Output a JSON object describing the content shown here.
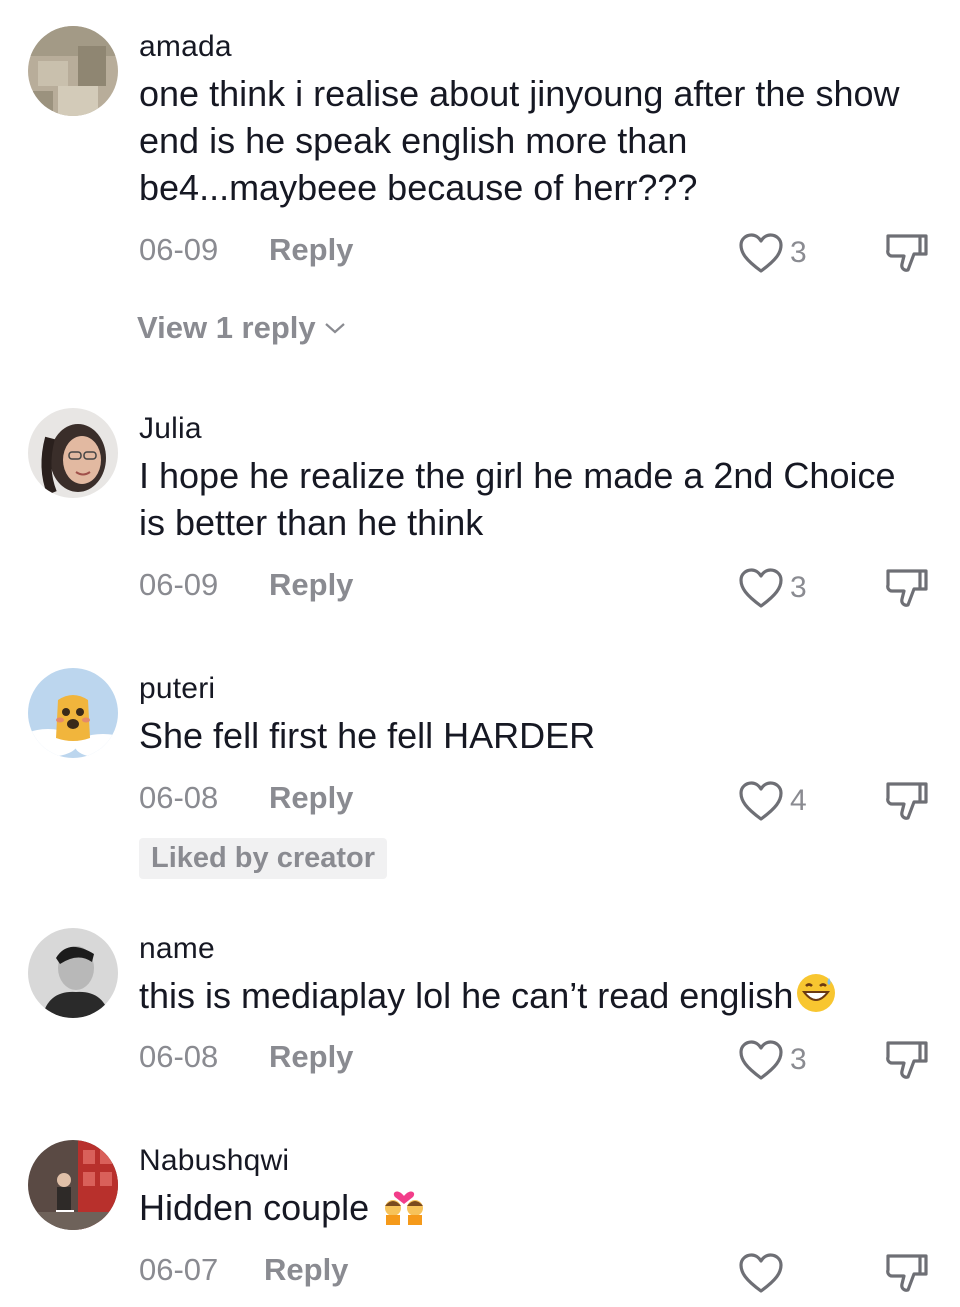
{
  "comments": [
    {
      "username": "amada",
      "text": "one think i realise about jinyoung after the show end is he speak english more than be4...maybeee because of herr???",
      "date": "06-09",
      "reply_label": "Reply",
      "likes": "3",
      "view_replies": "View 1 reply"
    },
    {
      "username": "Julia",
      "text": "I hope he realize the girl he made a 2nd Choice is better than he think",
      "date": "06-09",
      "reply_label": "Reply",
      "likes": "3"
    },
    {
      "username": "puteri",
      "text": "She fell first he fell HARDER",
      "date": "06-08",
      "reply_label": "Reply",
      "likes": "4",
      "badge": "Liked by creator"
    },
    {
      "username": "name",
      "text": "this is mediaplay lol he can’t read english",
      "emoji": "grinning-sweat-emoji",
      "date": "06-08",
      "reply_label": "Reply",
      "likes": "3"
    },
    {
      "username": "Nabushqwi",
      "text": "Hidden couple",
      "emoji": "couple-kiss-emoji",
      "date": "06-07",
      "reply_label": "Reply",
      "likes": ""
    }
  ],
  "icons": {
    "like": "heart-outline-icon",
    "dislike": "thumbs-down-outline-icon",
    "expand": "chevron-down-icon"
  },
  "colors": {
    "text": "#161823",
    "secondary": "#8a8b91",
    "badge_bg": "#f1f1f2"
  }
}
